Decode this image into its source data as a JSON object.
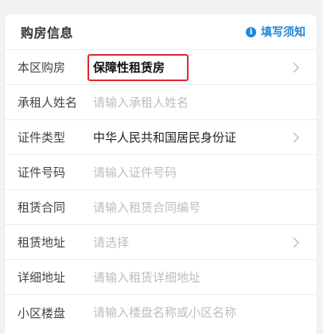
{
  "form": {
    "title": "购房信息",
    "notice_link": "填写须知",
    "notice_icon": "info-icon",
    "accent_color": "#1f86d4",
    "highlight_color": "#e0262d"
  },
  "rows": [
    {
      "label": "本区购房",
      "value": "保障性租赁房",
      "type": "select"
    },
    {
      "label": "承租人姓名",
      "placeholder": "请输入承租人姓名",
      "type": "input"
    },
    {
      "label": "证件类型",
      "value": "中华人民共和国居民身份证",
      "type": "select"
    },
    {
      "label": "证件号码",
      "placeholder": "请输入证件号码",
      "type": "input"
    },
    {
      "label": "租赁合同",
      "placeholder": "请输入租赁合同编号",
      "type": "input"
    },
    {
      "label": "租赁地址",
      "placeholder": "请选择",
      "type": "select"
    },
    {
      "label": "详细地址",
      "placeholder": "请输入租赁详细地址",
      "type": "input"
    },
    {
      "label": "小区楼盘",
      "placeholder": "请输入楼盘名称或小区名称",
      "type": "input"
    }
  ]
}
